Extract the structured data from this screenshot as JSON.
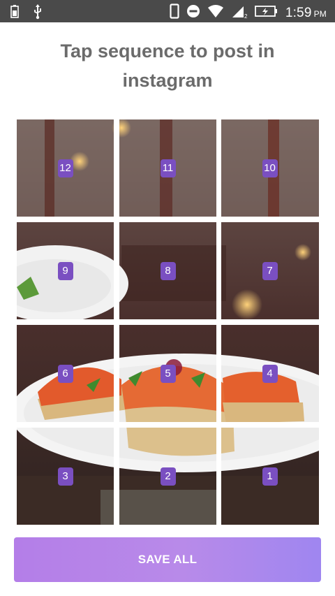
{
  "status_bar": {
    "time": "1:59",
    "ampm": "PM",
    "icons": [
      "battery-indicator-icon",
      "usb-icon",
      "phone-icon",
      "do-not-disturb-icon",
      "wifi-icon",
      "signal-icon",
      "battery-icon"
    ]
  },
  "title": "Tap sequence to post in instagram",
  "tiles": [
    {
      "label": "12"
    },
    {
      "label": "11"
    },
    {
      "label": "10"
    },
    {
      "label": "9"
    },
    {
      "label": "8"
    },
    {
      "label": "7"
    },
    {
      "label": "6"
    },
    {
      "label": "5"
    },
    {
      "label": "4"
    },
    {
      "label": "3"
    },
    {
      "label": "2"
    },
    {
      "label": "1"
    }
  ],
  "save_button": {
    "label": "SAVE ALL"
  },
  "colors": {
    "badge": "#7a4fc1",
    "title": "#6b6b6b",
    "status_bar": "#4a4a4a",
    "button_start": "#b47ee8",
    "button_end": "#9f86f0"
  }
}
